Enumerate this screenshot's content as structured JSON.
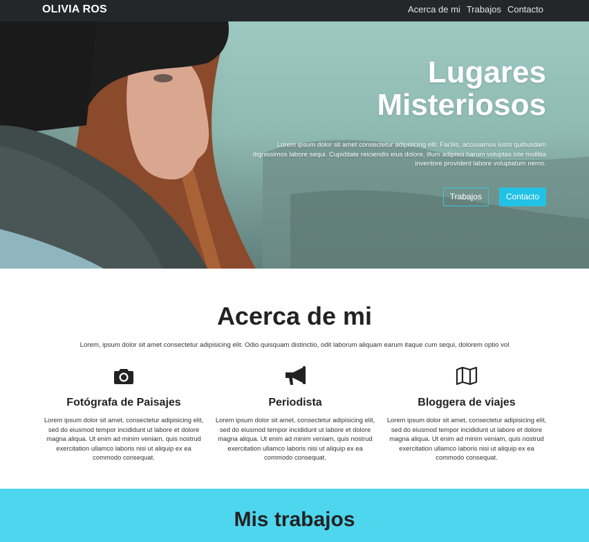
{
  "navbar": {
    "brand": "OLIVIA ROS",
    "links": [
      "Acerca de mi",
      "Trabajos",
      "Contacto"
    ]
  },
  "hero": {
    "title_line1": "Lugares",
    "title_line2": "Misteriosos",
    "text": "Lorem ipsum dolor sit amet consectetur adipisicing elit. Facilis, accusamus iusto quibusdam dignissimos labore sequi. Cupiditate reiciendis eius dolore, illum adipisci harum voluptas iste mollitia inventore provident labore voluptatum nemo.",
    "buttons": {
      "outline": "Trabajos",
      "primary": "Contacto"
    }
  },
  "about": {
    "title": "Acerca de mi",
    "intro": "Lorem, ipsum dolor sit amet consectetur adipisicing elit. Odio quisquam distinctio, odit laborum aliquam earum itaque cum sequi, dolorem optio vol",
    "features": [
      {
        "icon": "camera-icon",
        "title": "Fotógrafa de Paisajes",
        "text": "Lorem ipsum dolor sit amet, consectetur adipisicing elit, sed do eiusmod tempor incididunt ut labore et dolore magna aliqua. Ut enim ad minim veniam, quis nostrud exercitation ullamco laboris nisi ut aliquip ex ea commodo consequat."
      },
      {
        "icon": "megaphone-icon",
        "title": "Periodista",
        "text": "Lorem ipsum dolor sit amet, consectetur adipisicing elit, sed do eiusmod tempor incididunt ut labore et dolore magna aliqua. Ut enim ad minim veniam, quis nostrud exercitation ullamco laboris nisi ut aliquip ex ea commodo consequat."
      },
      {
        "icon": "map-icon",
        "title": "Bloggera de viajes",
        "text": "Lorem ipsum dolor sit amet, consectetur adipisicing elit, sed do eiusmod tempor incididunt ut labore et dolore magna aliqua. Ut enim ad minim veniam, quis nostrud exercitation ullamco laboris nisi ut aliquip ex ea commodo consequat."
      }
    ]
  },
  "works": {
    "title": "Mis trabajos"
  },
  "colors": {
    "navbar_bg": "#23272a",
    "accent": "#22c2e6",
    "works_bg": "#4ed6ef"
  }
}
